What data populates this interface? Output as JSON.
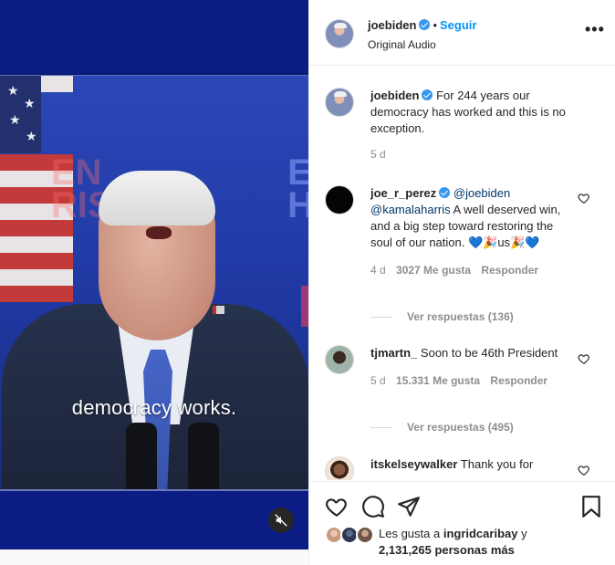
{
  "post": {
    "author": "joebiden",
    "follow_label": "Seguir",
    "dot": "•",
    "audio": "Original Audio",
    "more_icon": "more-options-icon",
    "more_label": "•••"
  },
  "media": {
    "caption": "democracy works.",
    "mute_icon": "muted-speaker-icon"
  },
  "caption_comment": {
    "username": "joebiden",
    "text": "For 244 years our democracy has worked and this is no exception.",
    "time": "5 d"
  },
  "comments": [
    {
      "username": "joe_r_perez",
      "mention1": "@joebiden",
      "mention2": "@kamalaharris",
      "text": "A well deserved win, and a big step toward restoring the soul of our nation. 💙🎉us🎉💙",
      "time": "4 d",
      "likes": "3027 Me gusta",
      "reply_label": "Responder",
      "view_replies": "Ver respuestas (136)"
    },
    {
      "username": "tjmartn_",
      "text": "Soon to be 46th President",
      "time": "5 d",
      "likes": "15.331 Me gusta",
      "reply_label": "Responder",
      "view_replies": "Ver respuestas (495)"
    },
    {
      "username": "itskelseywalker",
      "text": "Thank you for"
    }
  ],
  "likes_summary": {
    "line1": "Les gusta a ",
    "line1_user": "ingridcaribay",
    "line1_tail": " y",
    "line2": "2,131,265 personas más"
  },
  "colors": {
    "link": "#0095f6",
    "mention": "#00376b",
    "muted": "#8e8e8e",
    "verified": "#3897f0"
  }
}
